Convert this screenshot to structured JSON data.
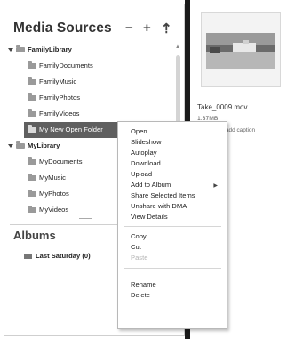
{
  "sidebar": {
    "title": "Media Sources",
    "buttons": {
      "remove": "−",
      "add": "+",
      "upload": "⇡"
    },
    "tree": [
      {
        "label": "FamilyLibrary",
        "type": "library"
      },
      {
        "label": "FamilyDocuments",
        "type": "folder"
      },
      {
        "label": "FamilyMusic",
        "type": "folder"
      },
      {
        "label": "FamilyPhotos",
        "type": "folder"
      },
      {
        "label": "FamilyVideos",
        "type": "folder"
      },
      {
        "label": "My New Open Folder",
        "type": "folder",
        "selected": true
      },
      {
        "label": "MyLibrary",
        "type": "library"
      },
      {
        "label": "MyDocuments",
        "type": "folder"
      },
      {
        "label": "MyMusic",
        "type": "folder"
      },
      {
        "label": "MyPhotos",
        "type": "folder"
      },
      {
        "label": "MyVideos",
        "type": "folder"
      }
    ]
  },
  "albums": {
    "title": "Albums",
    "items": [
      {
        "label": "Last Saturday (0)"
      }
    ]
  },
  "context_menu": {
    "items": [
      {
        "label": "Open"
      },
      {
        "label": "Slideshow"
      },
      {
        "label": "Autoplay"
      },
      {
        "label": "Download"
      },
      {
        "label": "Upload"
      },
      {
        "label": "Add to Album",
        "submenu_arrow": "▶"
      },
      {
        "label": "Share Selected Items"
      },
      {
        "label": "Unshare with DMA"
      },
      {
        "label": "View Details"
      },
      {
        "label": "Copy"
      },
      {
        "label": "Cut"
      },
      {
        "label": "Paste",
        "disabled": true
      },
      {
        "label": "Rename"
      },
      {
        "label": "Delete"
      }
    ]
  },
  "preview": {
    "filename": "Take_0009.mov",
    "filesize": "1.37MB",
    "caption_link": "add caption"
  },
  "colors": {
    "selected_row": "#5f5f5f",
    "divider": "#1a1a1a",
    "disabled_text": "#b4b4b4"
  }
}
